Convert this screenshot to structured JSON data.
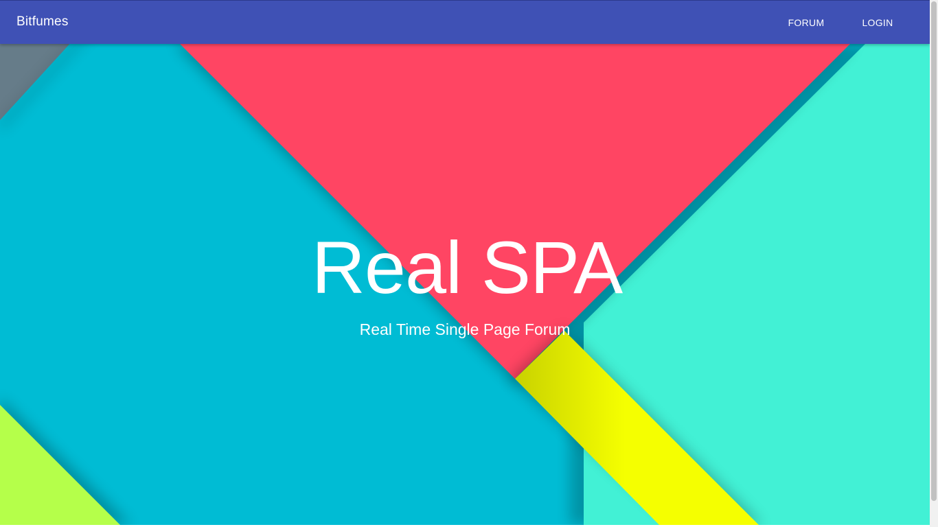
{
  "app": {
    "brand": "Bitfumes"
  },
  "nav": {
    "items": [
      {
        "label": "FORUM"
      },
      {
        "label": "LOGIN"
      }
    ]
  },
  "hero": {
    "title": "Real SPA",
    "subtitle": "Real Time Single Page Forum"
  },
  "colors": {
    "toolbar": "#3f51b5",
    "cyan": "#00bcd4",
    "red": "#ff4563",
    "teal": "#42f1d5",
    "yellow": "#f5ff00",
    "lime": "#b5ff4a",
    "slate": "#667c89"
  }
}
